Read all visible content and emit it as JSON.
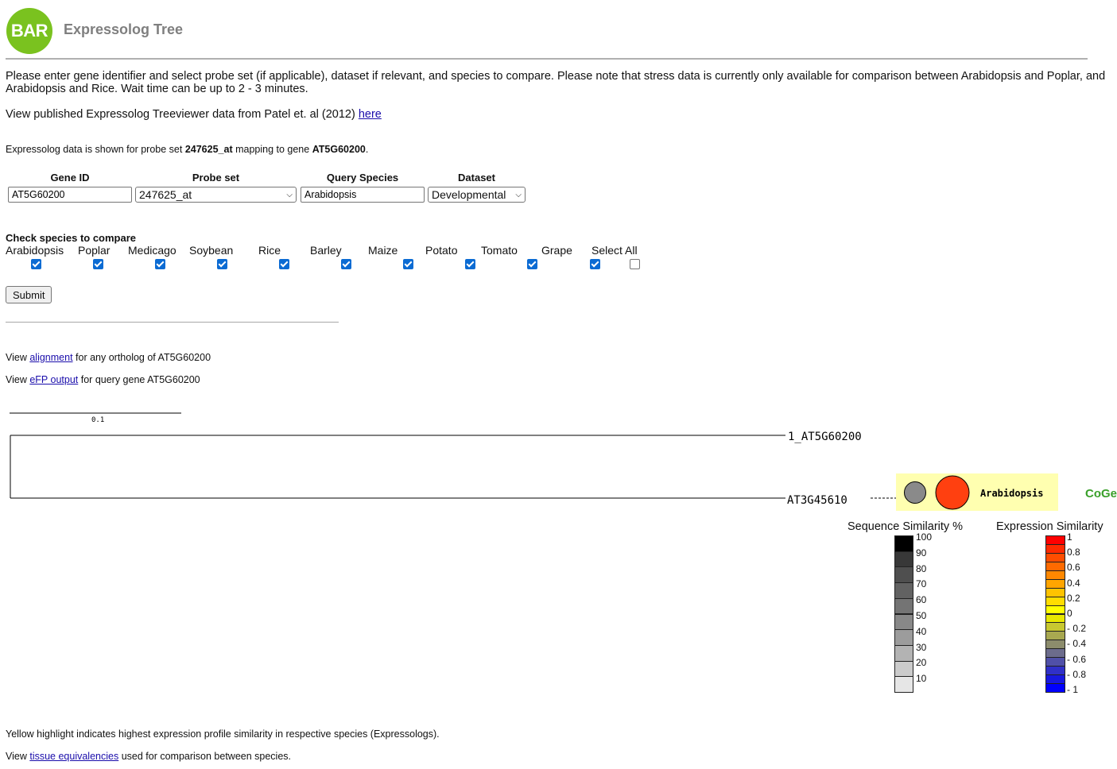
{
  "header": {
    "logo_text": "BAR",
    "title": "Expressolog Tree",
    "logo_color": "#7ac21f"
  },
  "intro": {
    "instructions": "Please enter gene identifier and select probe set (if applicable), dataset if relevant, and species to compare. Please note that stress data is currently only available for comparison between Arabidopsis and Poplar, and Arabidopsis and Rice. Wait time can be up to 2 - 3 minutes.",
    "published_prefix": "View published Expressolog Treeviewer data from Patel et. al (2012) ",
    "published_link": "here"
  },
  "mapping": {
    "prefix": "Expressolog data is shown for probe set ",
    "probe": "247625_at",
    "middle": " mapping to gene ",
    "gene": "AT5G60200",
    "suffix": "."
  },
  "form": {
    "gene_id_label": "Gene ID",
    "probe_set_label": "Probe set",
    "query_species_label": "Query Species",
    "dataset_label": "Dataset",
    "gene_id_value": "AT5G60200",
    "probe_set_value": "247625_at",
    "query_species_value": "Arabidopsis",
    "dataset_value": "Developmental",
    "check_label": "Check species to compare",
    "species": [
      {
        "name": "Arabidopsis",
        "checked": true
      },
      {
        "name": "Poplar",
        "checked": true
      },
      {
        "name": "Medicago",
        "checked": true
      },
      {
        "name": "Soybean",
        "checked": true
      },
      {
        "name": "Rice",
        "checked": true
      },
      {
        "name": "Barley",
        "checked": true
      },
      {
        "name": "Maize",
        "checked": true
      },
      {
        "name": "Potato",
        "checked": true
      },
      {
        "name": "Tomato",
        "checked": true
      },
      {
        "name": "Grape",
        "checked": true
      },
      {
        "name": "Select All",
        "checked": false
      }
    ],
    "submit_label": "Submit"
  },
  "links": {
    "view": "View ",
    "alignment_link": "alignment",
    "alignment_suffix": " for any ortholog of AT5G60200",
    "efp_link": "eFP output",
    "efp_suffix": " for query gene AT5G60200"
  },
  "tree": {
    "scale_label": "0.1",
    "leaf1": "1_AT5G60200",
    "leaf2": "AT3G45610",
    "species_label": "Arabidopsis",
    "coge_label": "CoGe",
    "highlight_color": "#ffffb0",
    "seq_circle_color": "#8a8a8a",
    "expr_circle_color": "#ff4010"
  },
  "legends": {
    "sequence_title": "Sequence Similarity %",
    "sequence_ticks": [
      "100",
      "90",
      "80",
      "70",
      "60",
      "50",
      "40",
      "30",
      "20",
      "10"
    ],
    "sequence_colors": [
      "#000000",
      "#383838",
      "#4f4f4f",
      "#626262",
      "#747474",
      "#888888",
      "#9c9c9c",
      "#b3b3b3",
      "#cbcbcb",
      "#e6e6e6"
    ],
    "expression_title": "Expression Similarity",
    "expression_ticks": [
      "1",
      "0.8",
      "0.6",
      "0.4",
      "0.2",
      "0",
      "- 0.2",
      "- 0.4",
      "- 0.6",
      "- 0.8",
      "- 1"
    ],
    "expression_colors": [
      "#ff0000",
      "#ff2a00",
      "#ff4d00",
      "#ff6a00",
      "#ff8800",
      "#ffa500",
      "#ffc300",
      "#ffdd00",
      "#ffff00",
      "#e8e800",
      "#c8c830",
      "#a8a850",
      "#8c8c6c",
      "#6c6c8c",
      "#5050a8",
      "#3030c8",
      "#1818e0",
      "#0000ff"
    ]
  },
  "footer": {
    "highlight_note": "Yellow highlight indicates highest expression profile similarity in respective species (Expressologs).",
    "tissue_prefix": "View ",
    "tissue_link": "tissue equivalencies",
    "tissue_suffix": " used for comparison between species."
  }
}
